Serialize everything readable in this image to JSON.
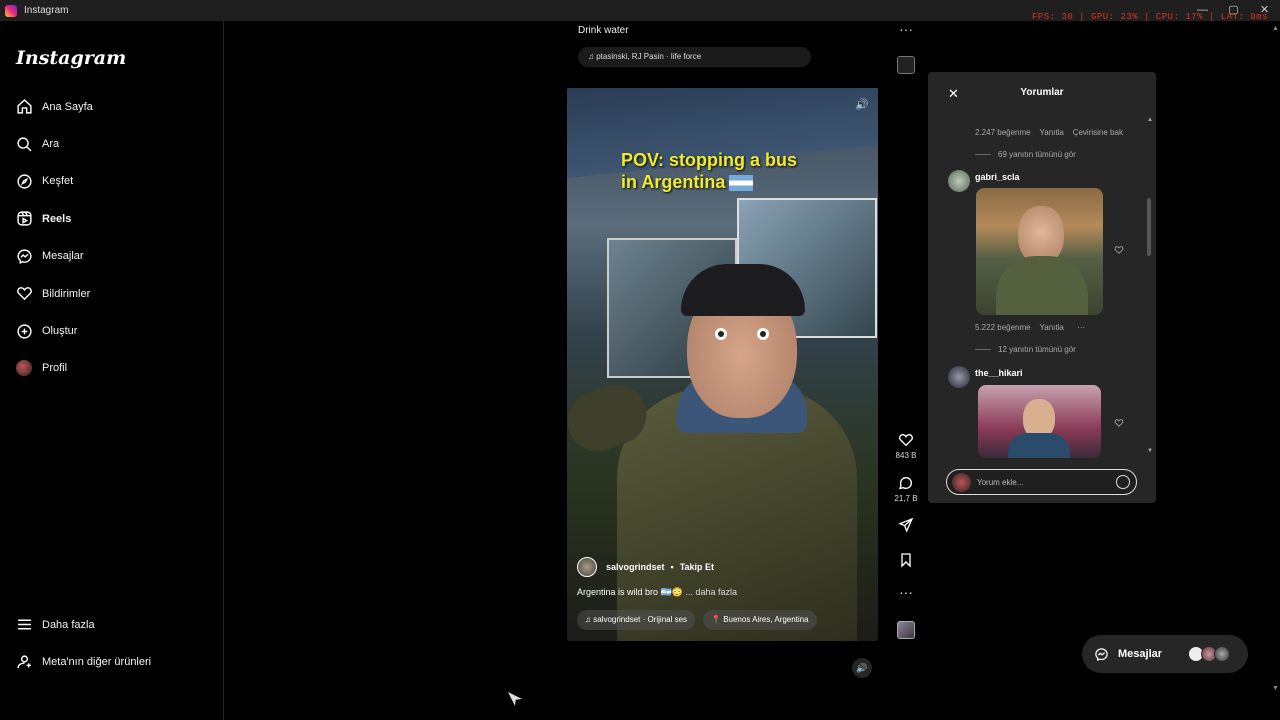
{
  "window": {
    "title": "Instagram",
    "controls": [
      "—",
      "▢",
      "✕"
    ]
  },
  "perf_overlay": "FPS: 30 | GPU: 23% | CPU: 17% | LAT: 0ms",
  "sidebar": {
    "logo": "Instagram",
    "items": [
      {
        "label": "Ana Sayfa",
        "icon": "home-icon"
      },
      {
        "label": "Ara",
        "icon": "search-icon"
      },
      {
        "label": "Keşfet",
        "icon": "compass-icon"
      },
      {
        "label": "Reels",
        "icon": "reels-icon",
        "active": true
      },
      {
        "label": "Mesajlar",
        "icon": "messenger-icon"
      },
      {
        "label": "Bildirimler",
        "icon": "heart-icon"
      },
      {
        "label": "Oluştur",
        "icon": "plus-square-icon"
      },
      {
        "label": "Profil",
        "icon": "avatar"
      }
    ],
    "bottom": [
      {
        "label": "Daha fazla",
        "icon": "menu-icon"
      },
      {
        "label": "Meta'nın diğer ürünleri",
        "icon": "grid-icon"
      }
    ]
  },
  "top_reel": {
    "title": "Drink water",
    "music": "ptasinski, RJ Pasin · life force"
  },
  "reel": {
    "overlay_text_line1": "POV: stopping a bus",
    "overlay_text_line2": "in Argentina",
    "username": "salvogrindset",
    "follow": "Takip Et",
    "caption": "Argentina is wild bro 🇦🇷😳",
    "more": "... daha fazla",
    "audio": "salvogrindset · Orijinal ses",
    "location": "Buenos Aires, Argentina"
  },
  "actions": {
    "likes": "843 B",
    "comments": "21,7 B"
  },
  "comments_panel": {
    "title": "Yorumlar",
    "c1": {
      "meta": "2.247 beğenme",
      "reply": "Yanıtla",
      "translate": "Çevirisine bak",
      "view_replies": "69 yanıtın tümünü gör"
    },
    "c2": {
      "user": "gabri_scla",
      "meta": "5.222 beğenme",
      "reply": "Yanıtla",
      "more": "···",
      "view_replies": "12 yanıtın tümünü gör"
    },
    "c3": {
      "user": "the__hikari"
    },
    "input_placeholder": "Yorum ekle..."
  },
  "messages_float": {
    "label": "Mesajlar"
  },
  "colors": {
    "accent_yellow": "#f2ec2a",
    "panel": "#262626",
    "bg": "#000000"
  }
}
